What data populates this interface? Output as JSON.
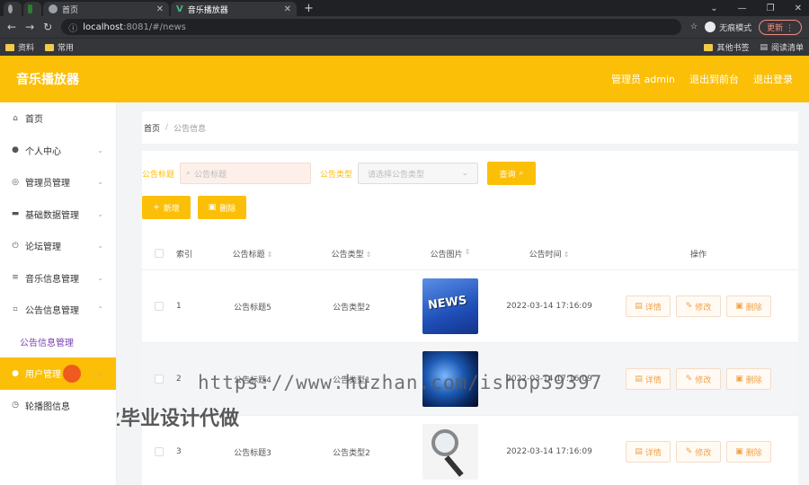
{
  "browser": {
    "tabs": [
      {
        "title": ""
      },
      {
        "title": ""
      },
      {
        "title": "首页"
      },
      {
        "title": "音乐播放器"
      }
    ],
    "url_host": "localhost",
    "url_rest": ":8081/#/news",
    "incognito_label": "无痕模式",
    "update_label": "更新",
    "bookmarks": [
      "资料",
      "常用"
    ],
    "bookmarks_right": [
      "其他书签",
      "阅读清单"
    ]
  },
  "header": {
    "app_title": "音乐播放器",
    "admin_label": "管理员 admin",
    "back_label": "退出到前台",
    "logout_label": "退出登录"
  },
  "sidebar": {
    "items": [
      {
        "label": "首页",
        "icon": "home-icon"
      },
      {
        "label": "个人中心",
        "icon": "user-icon"
      },
      {
        "label": "管理员管理",
        "icon": "compass-icon"
      },
      {
        "label": "基础数据管理",
        "icon": "data-icon"
      },
      {
        "label": "论坛管理",
        "icon": "power-icon"
      },
      {
        "label": "音乐信息管理",
        "icon": "list-icon"
      },
      {
        "label": "公告信息管理",
        "icon": "crop-icon"
      },
      {
        "label": "公告信息管理",
        "icon": ""
      },
      {
        "label": "用户管理",
        "icon": "user-icon"
      },
      {
        "label": "轮播图信息",
        "icon": "clock-icon"
      }
    ]
  },
  "breadcrumb": {
    "home": "首页",
    "current": "公告信息"
  },
  "search": {
    "title_label": "公告标题",
    "title_placeholder": "公告标题",
    "type_label": "公告类型",
    "type_placeholder": "请选择公告类型",
    "query_label": "查询"
  },
  "actions": {
    "add_label": "新增",
    "delete_label": "删除"
  },
  "table": {
    "headers": {
      "index": "索引",
      "title": "公告标题",
      "type": "公告类型",
      "image": "公告图片",
      "time": "公告时间",
      "ops": "操作"
    },
    "rows": [
      {
        "index": "1",
        "title": "公告标题5",
        "type": "公告类型2",
        "image": "news",
        "time": "2022-03-14 17:16:09"
      },
      {
        "index": "2",
        "title": "公告标题4",
        "type": "公告类型1",
        "image": "globe",
        "time": "2022-03-14 17:16:09"
      },
      {
        "index": "3",
        "title": "公告标题3",
        "type": "公告类型2",
        "image": "magnifier",
        "time": "2022-03-14 17:16:09"
      }
    ],
    "op_labels": {
      "detail": "详情",
      "edit": "修改",
      "delete": "删除"
    },
    "news_thumb_text": "NEWS"
  },
  "watermark": {
    "url_text": "https://www.huzhan.com/ishop39397",
    "slogan": "专业毕业设计代做"
  },
  "colors": {
    "accent": "#fcbf07",
    "active_sub": "#7b3fb5"
  }
}
